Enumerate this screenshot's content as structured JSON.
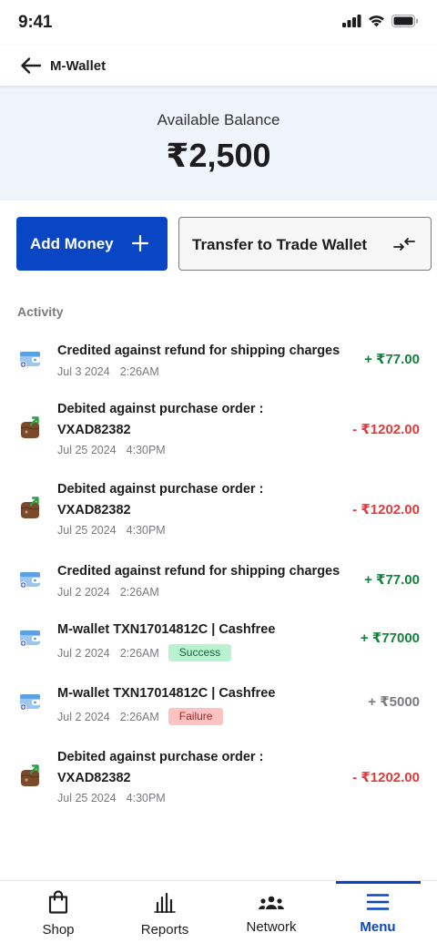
{
  "status": {
    "time": "9:41"
  },
  "header": {
    "title": "M-Wallet"
  },
  "balance": {
    "label": "Available Balance",
    "amount": "₹2,500"
  },
  "actions": {
    "add_money": "Add Money",
    "transfer": "Transfer to Trade Wallet"
  },
  "activity": {
    "title": "Activity",
    "items": [
      {
        "icon": "wallet-blue-icon",
        "title": "Credited against refund for shipping charges",
        "date": "Jul 3 2024",
        "time": "2:26AM",
        "amount": "+ ₹77.00",
        "status": ""
      },
      {
        "icon": "wallet-brown-icon",
        "title": "Debited against purchase order :",
        "title2": "VXAD82382",
        "date": "Jul 25 2024",
        "time": "4:30PM",
        "amount": "- ₹1202.00",
        "status": ""
      },
      {
        "icon": "wallet-brown-icon",
        "title": "Debited against purchase order :",
        "title2": "VXAD82382",
        "date": "Jul 25 2024",
        "time": "4:30PM",
        "amount": "- ₹1202.00",
        "status": ""
      },
      {
        "icon": "wallet-blue-icon",
        "title": "Credited against refund for shipping charges",
        "date": "Jul 2 2024",
        "time": "2:26AM",
        "amount": "+ ₹77.00",
        "status": ""
      },
      {
        "icon": "wallet-blue-icon",
        "title": "M-wallet TXN17014812C | Cashfree",
        "date": "Jul 2 2024",
        "time": "2:26AM",
        "amount": "+ ₹77000",
        "status": "Success"
      },
      {
        "icon": "wallet-blue-icon",
        "title": "M-wallet TXN17014812C | Cashfree",
        "date": "Jul 2 2024",
        "time": "2:26AM",
        "amount": "+ ₹5000",
        "status": "Failure"
      },
      {
        "icon": "wallet-brown-icon",
        "title": "Debited against purchase order :",
        "title2": "VXAD82382",
        "date": "Jul 25 2024",
        "time": "4:30PM",
        "amount": "- ₹1202.00",
        "status": ""
      }
    ]
  },
  "nav": {
    "items": [
      {
        "label": "Shop",
        "icon": "shopping-bag-icon"
      },
      {
        "label": "Reports",
        "icon": "bar-chart-icon"
      },
      {
        "label": "Network",
        "icon": "people-icon"
      },
      {
        "label": "Menu",
        "icon": "menu-icon"
      }
    ]
  },
  "colors": {
    "primary": "#0846c4",
    "credit": "#15803d",
    "debit": "#e03a3a",
    "balance_bg": "#eff4fb"
  }
}
